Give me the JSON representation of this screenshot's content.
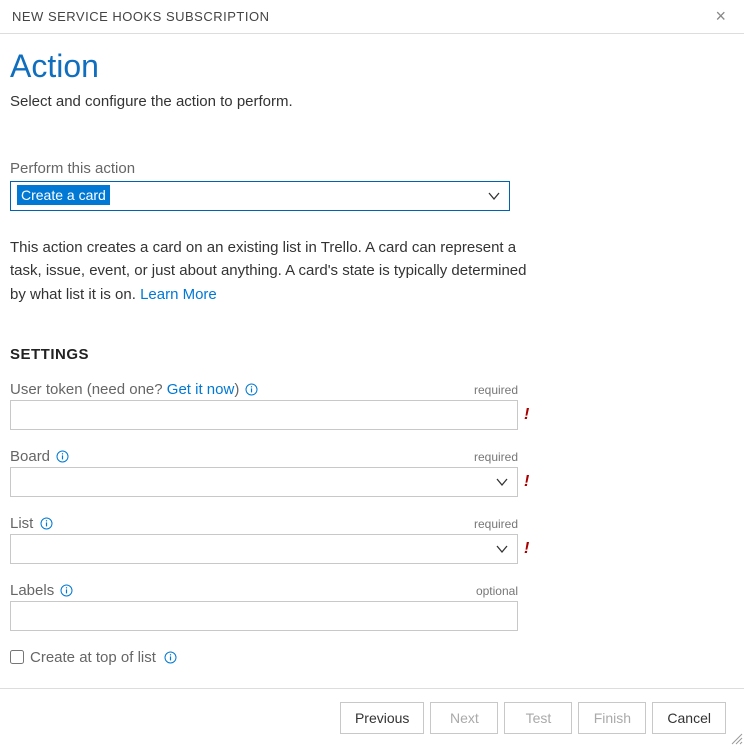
{
  "dialog": {
    "title": "NEW SERVICE HOOKS SUBSCRIPTION"
  },
  "page": {
    "heading": "Action",
    "subtitle": "Select and configure the action to perform."
  },
  "action_select": {
    "label": "Perform this action",
    "value": "Create a card"
  },
  "description": {
    "text": "This action creates a card on an existing list in Trello. A card can represent a task, issue, event, or just about anything. A card's state is typically determined by what list it is on. ",
    "learn_more": "Learn More"
  },
  "settings": {
    "heading": "SETTINGS",
    "fields": {
      "user_token": {
        "label_prefix": "User token (need one? ",
        "label_link": "Get it now",
        "label_suffix": ")",
        "requirement": "required",
        "value": "",
        "has_error": true
      },
      "board": {
        "label": "Board",
        "requirement": "required",
        "value": "",
        "has_error": true
      },
      "list": {
        "label": "List",
        "requirement": "required",
        "value": "",
        "has_error": true
      },
      "labels": {
        "label": "Labels",
        "requirement": "optional",
        "value": ""
      },
      "create_at_top": {
        "label": "Create at top of list",
        "checked": false
      }
    }
  },
  "footer": {
    "previous": "Previous",
    "next": "Next",
    "test": "Test",
    "finish": "Finish",
    "cancel": "Cancel"
  }
}
